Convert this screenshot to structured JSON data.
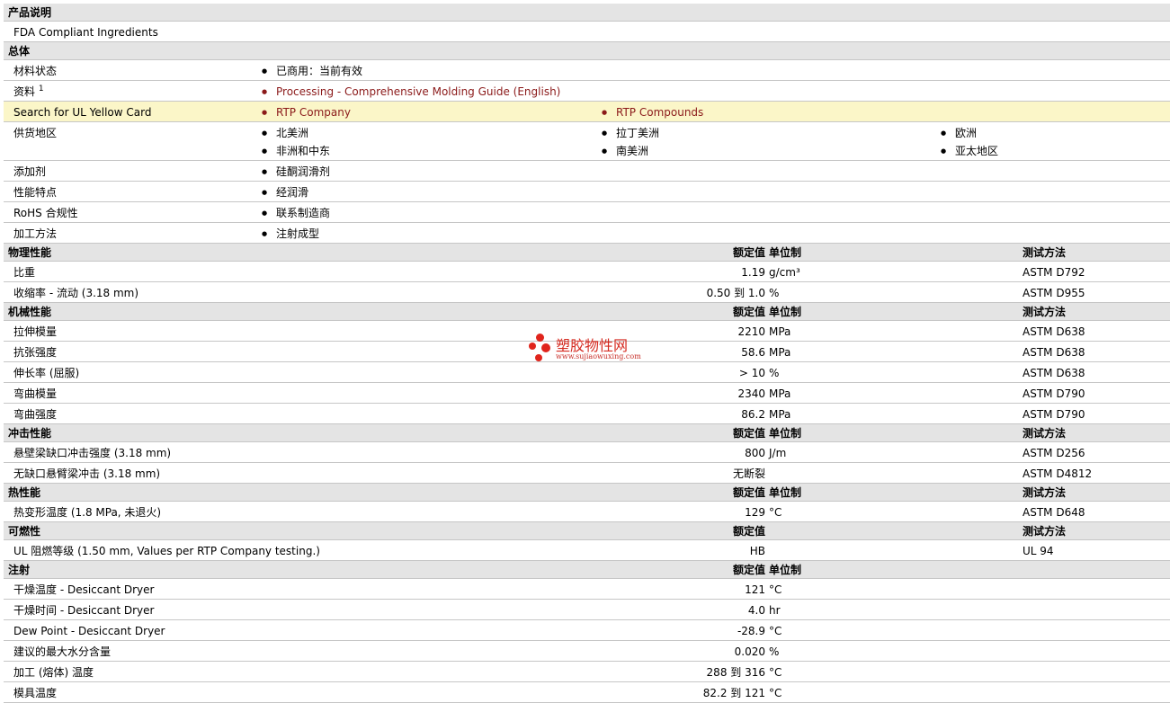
{
  "product_description": {
    "title": "产品说明",
    "text": "FDA Compliant Ingredients"
  },
  "general": {
    "title": "总体",
    "rows": [
      {
        "label": "材料状态",
        "items": [
          "已商用：当前有效"
        ]
      },
      {
        "label": "资料",
        "sup": "1",
        "items": [
          "Processing - Comprehensive Molding Guide (English)"
        ]
      },
      {
        "label": "Search for UL Yellow Card",
        "items": [
          "RTP Company",
          "RTP Compounds"
        ]
      },
      {
        "label": "供货地区",
        "items": [
          "北美洲",
          "拉丁美洲",
          "欧洲",
          "非洲和中东",
          "南美洲",
          "亚太地区"
        ]
      },
      {
        "label": "添加剂",
        "items": [
          "硅酮润滑剂"
        ]
      },
      {
        "label": "性能特点",
        "items": [
          "经润滑"
        ]
      },
      {
        "label": "RoHS 合规性",
        "items": [
          "联系制造商"
        ]
      },
      {
        "label": "加工方法",
        "items": [
          "注射成型"
        ]
      }
    ]
  },
  "headers": {
    "rated_value": "额定值",
    "unit_system": "单位制",
    "test_method": "测试方法"
  },
  "sections": [
    {
      "title": "物理性能",
      "rows": [
        {
          "label": "比重",
          "value": "1.19",
          "unit": "g/cm³",
          "method": "ASTM D792"
        },
        {
          "label": "收缩率 - 流动 (3.18 mm)",
          "value": "0.50 到  1.0",
          "unit": "%",
          "method": "ASTM D955"
        }
      ]
    },
    {
      "title": "机械性能",
      "rows": [
        {
          "label": "拉伸模量",
          "value": "2210",
          "unit": "MPa",
          "method": "ASTM D638"
        },
        {
          "label": "抗张强度",
          "value": "58.6",
          "unit": "MPa",
          "method": "ASTM D638"
        },
        {
          "label": "伸长率 (屈服)",
          "value": "> 10",
          "unit": "%",
          "method": "ASTM D638"
        },
        {
          "label": "弯曲模量",
          "value": "2340",
          "unit": "MPa",
          "method": "ASTM D790"
        },
        {
          "label": "弯曲强度",
          "value": "86.2",
          "unit": "MPa",
          "method": "ASTM D790"
        }
      ]
    },
    {
      "title": "冲击性能",
      "rows": [
        {
          "label": "悬壁梁缺口冲击强度 (3.18 mm)",
          "value": "800",
          "unit": "J/m",
          "method": "ASTM D256"
        },
        {
          "label": "无缺口悬臂梁冲击 (3.18 mm)",
          "value": "无断裂",
          "unit": "",
          "method": "ASTM D4812"
        }
      ]
    },
    {
      "title": "热性能",
      "rows": [
        {
          "label": "热变形温度 (1.8 MPa, 未退火)",
          "value": "129",
          "unit": "°C",
          "method": "ASTM D648"
        }
      ]
    },
    {
      "title": "可燃性",
      "no_unit_header": true,
      "rows": [
        {
          "label": "UL 阻燃等级 (1.50 mm, Values per RTP Company testing.)",
          "value": "HB",
          "unit": "",
          "method": "UL 94"
        }
      ]
    },
    {
      "title": "注射",
      "no_method_header": true,
      "rows": [
        {
          "label": "干燥温度 - Desiccant Dryer",
          "value": "121",
          "unit": "°C",
          "method": ""
        },
        {
          "label": "干燥时间 - Desiccant Dryer",
          "value": "4.0",
          "unit": "hr",
          "method": ""
        },
        {
          "label": "Dew Point - Desiccant Dryer",
          "value": "-28.9",
          "unit": "°C",
          "method": ""
        },
        {
          "label": "建议的最大水分含量",
          "value": "0.020",
          "unit": "%",
          "method": ""
        },
        {
          "label": "加工 (熔体) 温度",
          "value": "288 到  316",
          "unit": "°C",
          "method": ""
        },
        {
          "label": "模具温度",
          "value": "82.2 到  121",
          "unit": "°C",
          "method": ""
        }
      ]
    }
  ],
  "watermark": {
    "brand": "塑胶物性网",
    "url": "www.sujiaowuxing.com"
  },
  "colors": {
    "section_bg": "#e4e4e4",
    "highlight_bg": "#fbf6c8",
    "link": "#8b1a1a",
    "watermark_red": "#e0241c"
  }
}
